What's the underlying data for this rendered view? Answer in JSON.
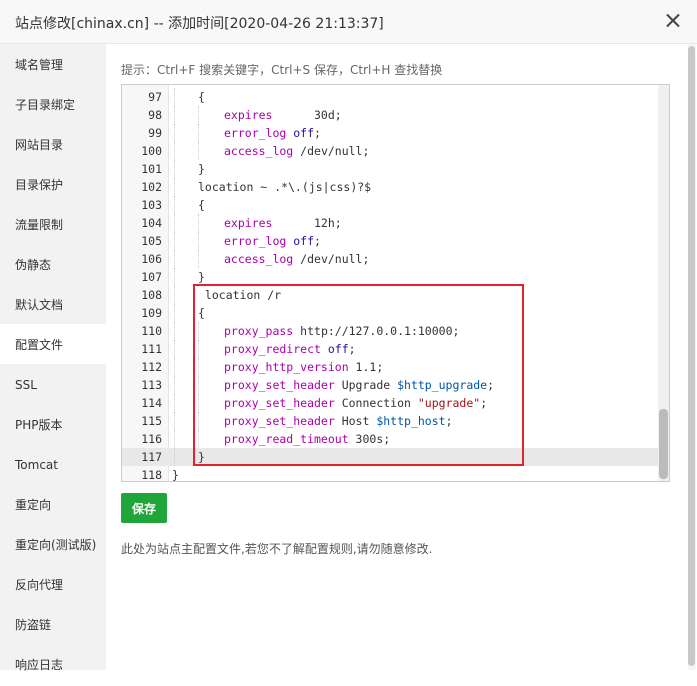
{
  "window": {
    "title": "站点修改[chinax.cn] -- 添加时间[2020-04-26 21:13:37]"
  },
  "sidebar": {
    "items": [
      {
        "label": "域名管理"
      },
      {
        "label": "子目录绑定"
      },
      {
        "label": "网站目录"
      },
      {
        "label": "目录保护"
      },
      {
        "label": "流量限制"
      },
      {
        "label": "伪静态"
      },
      {
        "label": "默认文档"
      },
      {
        "label": "配置文件",
        "active": true
      },
      {
        "label": "SSL"
      },
      {
        "label": "PHP版本"
      },
      {
        "label": "Tomcat"
      },
      {
        "label": "重定向"
      },
      {
        "label": "重定向(测试版)"
      },
      {
        "label": "反向代理"
      },
      {
        "label": "防盗链"
      },
      {
        "label": "响应日志"
      }
    ]
  },
  "hint": "提示：Ctrl+F 搜索关键字，Ctrl+S 保存，Ctrl+H 查找替换",
  "editor": {
    "active_line": 117,
    "lines": [
      {
        "n": "97",
        "g": 1,
        "parts": [
          {
            "t": "{"
          }
        ]
      },
      {
        "n": "98",
        "g": 2,
        "parts": [
          {
            "c": "kw",
            "t": "expires"
          },
          {
            "t": "      30d;"
          }
        ]
      },
      {
        "n": "99",
        "g": 2,
        "parts": [
          {
            "c": "kw",
            "t": "error_log"
          },
          {
            "t": " "
          },
          {
            "c": "kw2",
            "t": "off"
          },
          {
            "t": ";"
          }
        ]
      },
      {
        "n": "100",
        "g": 2,
        "parts": [
          {
            "c": "kw",
            "t": "access_log"
          },
          {
            "t": " /dev/null;"
          }
        ]
      },
      {
        "n": "101",
        "g": 1,
        "parts": [
          {
            "t": "}"
          }
        ]
      },
      {
        "n": "102",
        "g": 1,
        "parts": [
          {
            "t": "location ~ .*\\.(js|css)?$"
          }
        ]
      },
      {
        "n": "103",
        "g": 1,
        "parts": [
          {
            "t": "{"
          }
        ]
      },
      {
        "n": "104",
        "g": 2,
        "parts": [
          {
            "c": "kw",
            "t": "expires"
          },
          {
            "t": "      12h;"
          }
        ]
      },
      {
        "n": "105",
        "g": 2,
        "parts": [
          {
            "c": "kw",
            "t": "error_log"
          },
          {
            "t": " "
          },
          {
            "c": "kw2",
            "t": "off"
          },
          {
            "t": ";"
          }
        ]
      },
      {
        "n": "106",
        "g": 2,
        "parts": [
          {
            "c": "kw",
            "t": "access_log"
          },
          {
            "t": " /dev/null;"
          }
        ]
      },
      {
        "n": "107",
        "g": 1,
        "parts": [
          {
            "t": "}"
          }
        ]
      },
      {
        "n": "108",
        "g": 1,
        "parts": [
          {
            "t": " location /r"
          }
        ]
      },
      {
        "n": "109",
        "g": 1,
        "parts": [
          {
            "t": "{"
          }
        ]
      },
      {
        "n": "110",
        "g": 2,
        "parts": [
          {
            "c": "kw",
            "t": "proxy_pass"
          },
          {
            "t": " http://127.0.0.1:10000;"
          }
        ]
      },
      {
        "n": "111",
        "g": 2,
        "parts": [
          {
            "c": "kw",
            "t": "proxy_redirect"
          },
          {
            "t": " "
          },
          {
            "c": "kw2",
            "t": "off"
          },
          {
            "t": ";"
          }
        ]
      },
      {
        "n": "112",
        "g": 2,
        "parts": [
          {
            "c": "kw",
            "t": "proxy_http_version"
          },
          {
            "t": " 1.1;"
          }
        ]
      },
      {
        "n": "113",
        "g": 2,
        "parts": [
          {
            "c": "kw",
            "t": "proxy_set_header"
          },
          {
            "t": " Upgrade "
          },
          {
            "c": "var",
            "t": "$http_upgrade"
          },
          {
            "t": ";"
          }
        ]
      },
      {
        "n": "114",
        "g": 2,
        "parts": [
          {
            "c": "kw",
            "t": "proxy_set_header"
          },
          {
            "t": " Connection "
          },
          {
            "c": "str",
            "t": "\"upgrade\""
          },
          {
            "t": ";"
          }
        ]
      },
      {
        "n": "115",
        "g": 2,
        "parts": [
          {
            "c": "kw",
            "t": "proxy_set_header"
          },
          {
            "t": " Host "
          },
          {
            "c": "var",
            "t": "$http_host"
          },
          {
            "t": ";"
          }
        ]
      },
      {
        "n": "116",
        "g": 2,
        "parts": [
          {
            "c": "kw",
            "t": "proxy_read_timeout"
          },
          {
            "t": " 300s;"
          }
        ]
      },
      {
        "n": "117",
        "g": 1,
        "parts": [
          {
            "t": "}"
          }
        ]
      },
      {
        "n": "118",
        "g": 0,
        "parts": [
          {
            "t": "}"
          }
        ]
      }
    ]
  },
  "save_label": "保存",
  "note": "此处为站点主配置文件,若您不了解配置规则,请勿随意修改.",
  "colors": {
    "save_button": "#20a53a",
    "highlight_border": "#e0242b",
    "keyword": "#aa00aa",
    "variable": "#0055aa"
  }
}
